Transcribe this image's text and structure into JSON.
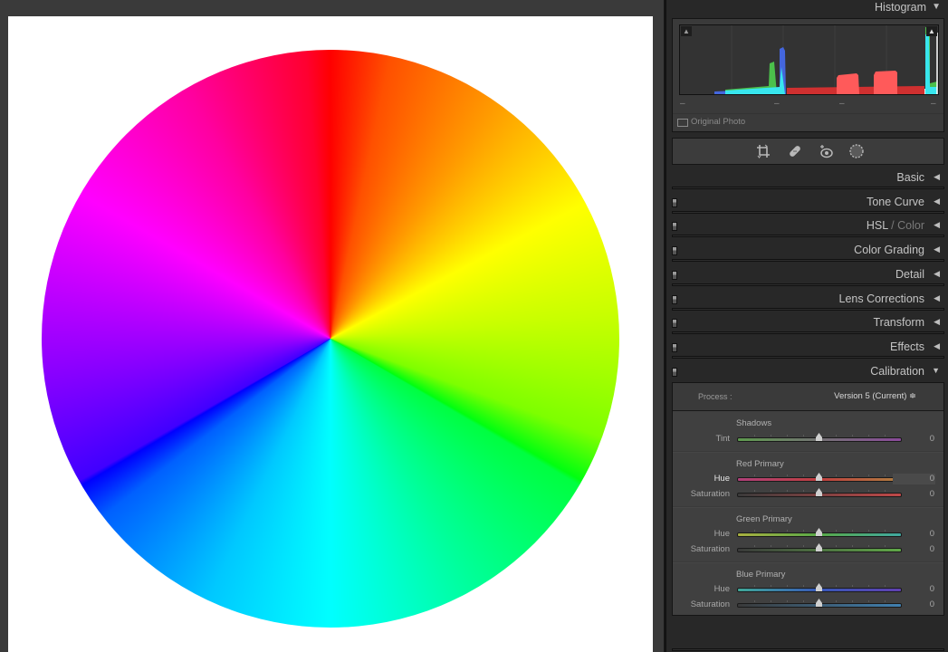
{
  "canvas": {
    "image_description": "RGB hue color wheel",
    "background": "#ffffff"
  },
  "histogram": {
    "title": "Histogram",
    "expanded": true,
    "shadow_clip_icon": "triangle-up-icon",
    "highlight_clip_icon": "triangle-up-icon",
    "meta": [
      "–",
      "–",
      "–",
      "–"
    ],
    "original_photo_label": "Original Photo",
    "original_photo_checked": false,
    "channel_colors": {
      "red": "#ff5a5a",
      "green": "#4bc04b",
      "blue": "#4466dd",
      "cyan": "#38e6ee",
      "luminance": "#e6e6e6"
    }
  },
  "tools": [
    {
      "name": "crop-tool",
      "icon": "crop-icon"
    },
    {
      "name": "healing-tool",
      "icon": "bandage-icon"
    },
    {
      "name": "red-eye-tool",
      "icon": "eye-icon"
    },
    {
      "name": "masking-tool",
      "icon": "mask-circle-icon"
    }
  ],
  "panels": [
    {
      "id": "basic",
      "label": "Basic",
      "expanded": false,
      "has_switch": false
    },
    {
      "id": "tone-curve",
      "label": "Tone Curve",
      "expanded": false,
      "has_switch": true
    },
    {
      "id": "hsl",
      "label": "HSL",
      "label_sep": " / ",
      "label_dim": "Color",
      "expanded": false,
      "has_switch": true
    },
    {
      "id": "color-grading",
      "label": "Color Grading",
      "expanded": false,
      "has_switch": true
    },
    {
      "id": "detail",
      "label": "Detail",
      "expanded": false,
      "has_switch": true
    },
    {
      "id": "lens-corrections",
      "label": "Lens Corrections",
      "expanded": false,
      "has_switch": true
    },
    {
      "id": "transform",
      "label": "Transform",
      "expanded": false,
      "has_switch": true
    },
    {
      "id": "effects",
      "label": "Effects",
      "expanded": false,
      "has_switch": true
    },
    {
      "id": "calibration",
      "label": "Calibration",
      "expanded": true,
      "has_switch": true
    }
  ],
  "arrows": {
    "collapsed": "◀",
    "expanded": "▼"
  },
  "calibration": {
    "process_label": "Process :",
    "process_value": "Version 5 (Current) ≑",
    "groups": [
      {
        "title": "Shadows",
        "sliders": [
          {
            "label": "Tint",
            "value": "0",
            "position": 0.5,
            "gradient": [
              "#5e9a4e",
              "#8a4a9a"
            ],
            "active": false
          }
        ]
      },
      {
        "title": "Red Primary",
        "sliders": [
          {
            "label": "Hue",
            "value": "0",
            "position": 0.5,
            "gradient": [
              "#b0407a",
              "#c04040",
              "#b08040"
            ],
            "active": true
          },
          {
            "label": "Saturation",
            "value": "0",
            "position": 0.5,
            "gradient": [
              "#3a3a3a",
              "#c04848"
            ],
            "active": false
          }
        ]
      },
      {
        "title": "Green Primary",
        "sliders": [
          {
            "label": "Hue",
            "value": "0",
            "position": 0.5,
            "gradient": [
              "#a8b040",
              "#58a848",
              "#40a8a0"
            ],
            "active": false
          },
          {
            "label": "Saturation",
            "value": "0",
            "position": 0.5,
            "gradient": [
              "#3a3a3a",
              "#60a848"
            ],
            "active": false
          }
        ]
      },
      {
        "title": "Blue Primary",
        "sliders": [
          {
            "label": "Hue",
            "value": "0",
            "position": 0.5,
            "gradient": [
              "#40a898",
              "#3858b8",
              "#6040b0"
            ],
            "active": false
          },
          {
            "label": "Saturation",
            "value": "0",
            "position": 0.5,
            "gradient": [
              "#3a3a3a",
              "#4080b0"
            ],
            "active": false
          }
        ]
      }
    ]
  }
}
